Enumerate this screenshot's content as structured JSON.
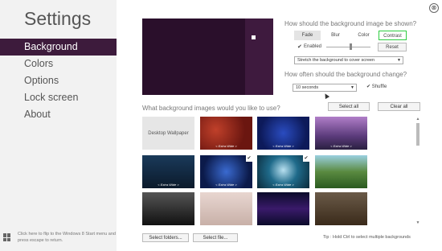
{
  "sidebar": {
    "title": "Settings",
    "items": [
      {
        "label": "Background"
      },
      {
        "label": "Colors"
      },
      {
        "label": "Options"
      },
      {
        "label": "Lock screen"
      },
      {
        "label": "About"
      }
    ],
    "footer": "Click here to flip to the Windows 8 Start menu and press escape to return."
  },
  "close_glyph": "⊗",
  "show": {
    "question": "How should the background image be shown?",
    "tabs": [
      "Fade",
      "Blur",
      "Color",
      "Contrast"
    ],
    "enabled_check": "✔",
    "enabled_label": "Enabled",
    "slider_value": 0.55,
    "reset_label": "Reset",
    "stretch_option": "Stretch the background to cover screen"
  },
  "change": {
    "question": "How often should the background change?",
    "interval": "10 seconds",
    "shuffle_check": "✔",
    "shuffle_label": "Shuffle"
  },
  "images": {
    "question": "What background images would you like to use?",
    "select_all": "Select all",
    "clear_all": "Clear all",
    "desktop_wallpaper": "Desktop Wallpaper",
    "caption": "< Extra Wide >",
    "select_folders": "Select folders...",
    "select_file": "Select file...",
    "tip": "Tip : Hold Ctrl to select multiple backgrounds"
  },
  "colors": {
    "accent": "#3d1b3c",
    "highlight": "#2ecc40"
  }
}
